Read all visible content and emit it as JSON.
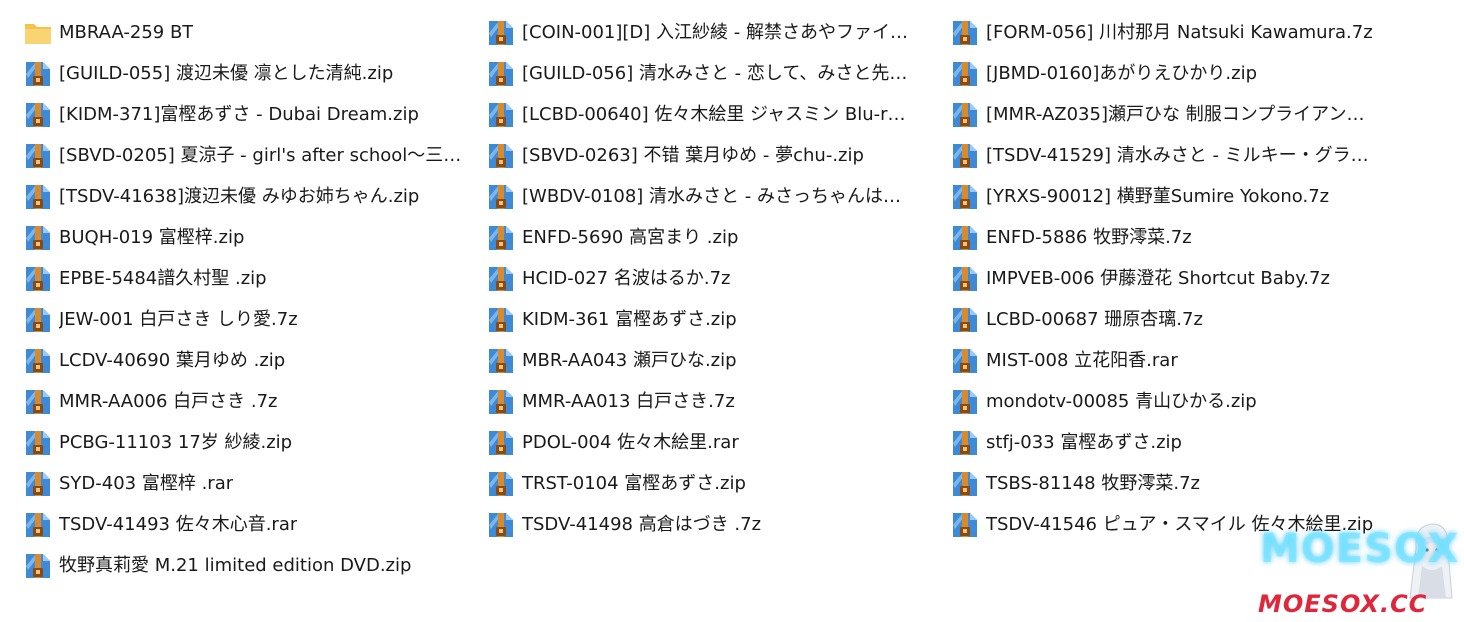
{
  "columns": [
    [
      {
        "name": "MBRAA-259 BT",
        "type": "folder"
      },
      {
        "name": "[GUILD-055] 渡辺未優 凛とした清純.zip",
        "type": "archive"
      },
      {
        "name": "[KIDM-371]富樫あずさ - Dubai Dream.zip",
        "type": "archive"
      },
      {
        "name": "[SBVD-0205] 夏涼子 - girl's after school～三…",
        "type": "archive"
      },
      {
        "name": "[TSDV-41638]渡辺未優 みゆお姉ちゃん.zip",
        "type": "archive"
      },
      {
        "name": "BUQH-019 富樫梓.zip",
        "type": "archive"
      },
      {
        "name": "EPBE-5484譜久村聖 .zip",
        "type": "archive"
      },
      {
        "name": "JEW-001 白戸さき しり愛.7z",
        "type": "archive"
      },
      {
        "name": "LCDV-40690 葉月ゆめ .zip",
        "type": "archive"
      },
      {
        "name": "MMR-AA006 白戸さき .7z",
        "type": "archive"
      },
      {
        "name": "PCBG-11103 17岁 紗綾.zip",
        "type": "archive"
      },
      {
        "name": "SYD-403 富樫梓 .rar",
        "type": "archive"
      },
      {
        "name": "TSDV-41493 佐々木心音.rar",
        "type": "archive"
      },
      {
        "name": "牧野真莉愛 M.21 limited edition DVD.zip",
        "type": "archive"
      }
    ],
    [
      {
        "name": "[COIN-001][D] 入江紗綾 - 解禁さあやファイ…",
        "type": "archive"
      },
      {
        "name": "[GUILD-056] 清水みさと - 恋して、みさと先…",
        "type": "archive"
      },
      {
        "name": "[LCBD-00640] 佐々木絵里 ジャスミン Blu-r…",
        "type": "archive"
      },
      {
        "name": "[SBVD-0263] 不错 葉月ゆめ - 夢chu-.zip",
        "type": "archive"
      },
      {
        "name": "[WBDV-0108] 清水みさと - みさっちゃんは…",
        "type": "archive"
      },
      {
        "name": "ENFD-5690 高宮まり .zip",
        "type": "archive"
      },
      {
        "name": "HCID-027 名波はるか.7z",
        "type": "archive"
      },
      {
        "name": "KIDM-361 富樫あずさ.zip",
        "type": "archive"
      },
      {
        "name": "MBR-AA043 瀬戸ひな.zip",
        "type": "archive"
      },
      {
        "name": "MMR-AA013 白戸さき.7z",
        "type": "archive"
      },
      {
        "name": "PDOL-004 佐々木絵里.rar",
        "type": "archive"
      },
      {
        "name": "TRST-0104 富樫あずさ.zip",
        "type": "archive"
      },
      {
        "name": "TSDV-41498 高倉はづき .7z",
        "type": "archive"
      }
    ],
    [
      {
        "name": "[FORM-056] 川村那月  Natsuki Kawamura.7z",
        "type": "archive"
      },
      {
        "name": "[JBMD-0160]あがりえひかり.zip",
        "type": "archive"
      },
      {
        "name": "[MMR-AZ035]瀬戸ひな 制服コンプライアン…",
        "type": "archive"
      },
      {
        "name": "[TSDV-41529] 清水みさと - ミルキー・グラ…",
        "type": "archive"
      },
      {
        "name": "[YRXS-90012] 横野菫Sumire Yokono.7z",
        "type": "archive"
      },
      {
        "name": "ENFD-5886 牧野澪菜.7z",
        "type": "archive"
      },
      {
        "name": "IMPVEB-006 伊藤澄花 Shortcut Baby.7z",
        "type": "archive"
      },
      {
        "name": "LCBD-00687 珊原杏璃.7z",
        "type": "archive"
      },
      {
        "name": "MIST-008 立花阳香.rar",
        "type": "archive"
      },
      {
        "name": "mondotv-00085 青山ひかる.zip",
        "type": "archive"
      },
      {
        "name": "stfj-033 富樫あずさ.zip",
        "type": "archive"
      },
      {
        "name": "TSBS-81148 牧野澪菜.7z",
        "type": "archive"
      },
      {
        "name": "TSDV-41546 ピュア・スマイル 佐々木絵里.zip",
        "type": "archive"
      }
    ]
  ],
  "icons": {
    "folder": "folder-icon",
    "archive": "archive-file-icon"
  },
  "colors": {
    "folder": "#f3c34a",
    "archive_body": "#3f8ad6",
    "archive_strap": "#d98b2b",
    "watermark_cyan": "#78e6ff",
    "watermark_red": "#e0263a"
  },
  "watermark": {
    "logo": "MOESOX",
    "site": "MOESOX.CC"
  }
}
